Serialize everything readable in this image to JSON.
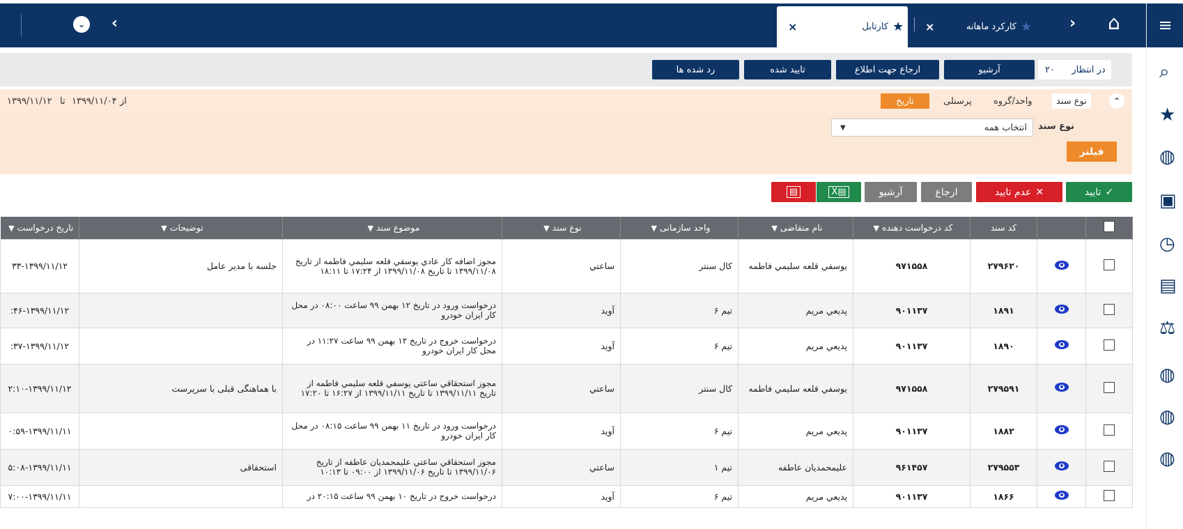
{
  "topbar": {
    "tabs": [
      {
        "label": "کارتابل",
        "active": true
      },
      {
        "label": "کارکرد ماهانه",
        "active": false
      }
    ],
    "close_glyph": "×",
    "home_icon": "home-icon",
    "menu_icon": "hamburger-menu-icon"
  },
  "sub_tabs": [
    {
      "label": "در انتظار",
      "count": "۲۰",
      "selected": true
    },
    {
      "label": "آرشیو"
    },
    {
      "label": "ارجاع جهت اطلاع"
    },
    {
      "label": "تایید شده"
    },
    {
      "label": "رد شده ها"
    }
  ],
  "filter": {
    "tabs": [
      "نوع سند",
      "واحد/گروه",
      "پرسنلی",
      "تاریخ"
    ],
    "date_from_label": "از",
    "date_from": "۱۳۹۹/۱۱/۰۴",
    "date_to_label": "تا",
    "date_to": "۱۳۹۹/۱۱/۱۲",
    "doc_type_label": "نوع سند",
    "doc_type_value": "انتخاب همه",
    "filter_button": "فیلتر"
  },
  "actions": {
    "approve": "تایید",
    "reject": "عدم تایید",
    "refer": "ارجاع",
    "archive": "آرشیو",
    "excel_icon": "excel-icon",
    "pdf_icon": "pdf-icon"
  },
  "table": {
    "columns": [
      "کد سند",
      "کد درخواست دهنده",
      "نام متقاضی",
      "واحد سازمانی",
      "نوع سند",
      "موضوع سند",
      "توضیحات",
      "تاریخ درخواست"
    ],
    "rows": [
      {
        "doc_code": "۲۷۹۶۲۰",
        "req_code": "۹۷۱۵۵۸",
        "name": "یوسفي قلعه سليمي فاطمه",
        "unit": "کال سنتر",
        "type": "ساعتي",
        "subject": "مجوز اضافه کار عادي يوسفي قلعه سليمي فاطمه از تاریخ ۱۳۹۹/۱۱/۰۸ تا تاریخ ۱۳۹۹/۱۱/۰۸ از ۱۷:۲۴ تا ۱۸:۱۱",
        "desc": "جلسه با مدیر عامل",
        "date": "۳۳-۱۳۹۹/۱۱/۱۲"
      },
      {
        "doc_code": "۱۸۹۱",
        "req_code": "۹۰۱۱۳۷",
        "name": "پديعي مريم",
        "unit": "تیم ۶",
        "type": "آوید",
        "subject": "درخواست ورود در تاریخ ۱۲ بهمن ۹۹ ساعت ۰۸:۰۰ در محل کار ایران خودرو",
        "desc": "",
        "date": ":۴۶-۱۳۹۹/۱۱/۱۲"
      },
      {
        "doc_code": "۱۸۹۰",
        "req_code": "۹۰۱۱۳۷",
        "name": "پديعي مريم",
        "unit": "تیم ۶",
        "type": "آوید",
        "subject": "درخواست خروج در تاریخ ۱۲ بهمن ۹۹ ساعت ۱۱:۲۷ در محل کار ایران خودرو",
        "desc": "",
        "date": ":۳۷-۱۳۹۹/۱۱/۱۲"
      },
      {
        "doc_code": "۲۷۹۵۹۱",
        "req_code": "۹۷۱۵۵۸",
        "name": "یوسفي قلعه سليمي فاطمه",
        "unit": "کال سنتر",
        "type": "ساعتي",
        "subject": "مجوز استحقاقي ساعتي يوسفي قلعه سليمي فاطمه از تاریخ ۱۳۹۹/۱۱/۱۱ تا تاریخ ۱۳۹۹/۱۱/۱۱ از ۱۶:۲۷ تا ۱۷:۲۰",
        "desc": "با هماهنگی قبلی با سرپرست",
        "date": "۲:۱۰-۱۳۹۹/۱۱/۱۲"
      },
      {
        "doc_code": "۱۸۸۲",
        "req_code": "۹۰۱۱۳۷",
        "name": "پديعي مريم",
        "unit": "تیم ۶",
        "type": "آوید",
        "subject": "درخواست ورود در تاریخ ۱۱ بهمن ۹۹ ساعت ۰۸:۱۵ در محل کار ایران خودرو",
        "desc": "",
        "date": "۰:۵۹-۱۳۹۹/۱۱/۱۱"
      },
      {
        "doc_code": "۲۷۹۵۵۳",
        "req_code": "۹۶۱۴۵۷",
        "name": "عليمحمديان عاطفه",
        "unit": "تیم ۱",
        "type": "ساعتي",
        "subject": "مجوز استحقاقي ساعتي عليمحمديان عاطفه از تاریخ ۱۳۹۹/۱۱/۰۶ تا تاریخ ۱۳۹۹/۱۱/۰۶ از ۰۹:۰۰ تا ۱۰:۱۳",
        "desc": "استحقاقی",
        "date": "۵:۰۸-۱۳۹۹/۱۱/۱۱"
      },
      {
        "doc_code": "۱۸۶۶",
        "req_code": "۹۰۱۱۳۷",
        "name": "پديعي مريم",
        "unit": "تیم ۶",
        "type": "آوید",
        "subject": "درخواست خروج در تاریخ ۱۰ بهمن ۹۹ ساعت ۲۰:۱۵ در",
        "desc": "",
        "date": "۷:۰۰-۱۳۹۹/۱۱/۱۱"
      }
    ]
  },
  "colors": {
    "navy": "#0e3466",
    "green": "#1f8a4c",
    "red": "#d72027",
    "gray": "#7d7d7d",
    "orange": "#ee8a29"
  }
}
